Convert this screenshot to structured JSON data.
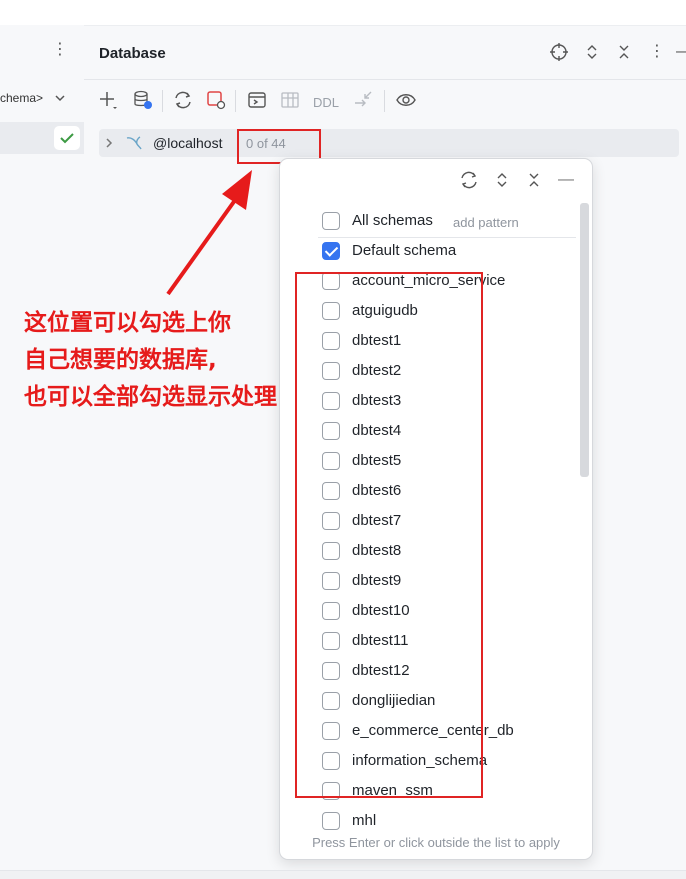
{
  "left_panel": {
    "schema_label": "chema>"
  },
  "database_panel": {
    "title": "Database",
    "toolbar": {
      "ddl_label": "DDL"
    }
  },
  "tree": {
    "host_label": "@localhost",
    "schema_count": "0 of 44"
  },
  "schema_popup": {
    "all_schemas_label": "All schemas",
    "add_pattern_label": "add pattern",
    "items": [
      {
        "label": "Default schema",
        "checked": true
      },
      {
        "label": "account_micro_service",
        "checked": false
      },
      {
        "label": "atguigudb",
        "checked": false
      },
      {
        "label": "dbtest1",
        "checked": false
      },
      {
        "label": "dbtest2",
        "checked": false
      },
      {
        "label": "dbtest3",
        "checked": false
      },
      {
        "label": "dbtest4",
        "checked": false
      },
      {
        "label": "dbtest5",
        "checked": false
      },
      {
        "label": "dbtest6",
        "checked": false
      },
      {
        "label": "dbtest7",
        "checked": false
      },
      {
        "label": "dbtest8",
        "checked": false
      },
      {
        "label": "dbtest9",
        "checked": false
      },
      {
        "label": "dbtest10",
        "checked": false
      },
      {
        "label": "dbtest11",
        "checked": false
      },
      {
        "label": "dbtest12",
        "checked": false
      },
      {
        "label": "donglijiedian",
        "checked": false
      },
      {
        "label": "e_commerce_center_db",
        "checked": false
      },
      {
        "label": "information_schema",
        "checked": false
      },
      {
        "label": "maven_ssm",
        "checked": false
      },
      {
        "label": "mhl",
        "checked": false
      }
    ],
    "footer_hint": "Press Enter or click outside the list to apply"
  },
  "annotation": {
    "lines": [
      "这位置可以勾选上你",
      "自己想要的数据库,",
      "也可以全部勾选显示处理"
    ],
    "color": "#e61b1b"
  },
  "colors": {
    "accent": "#3574f0",
    "annotation_red": "#e02424"
  }
}
